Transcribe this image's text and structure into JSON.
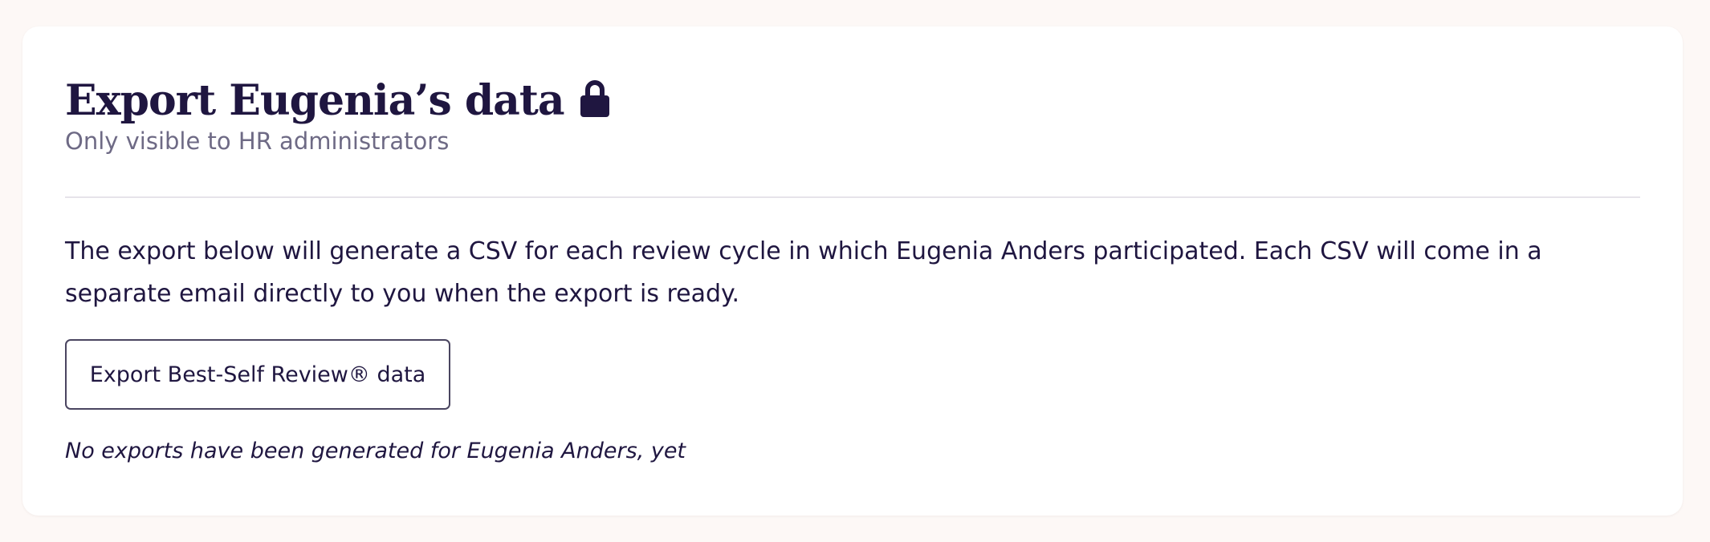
{
  "header": {
    "title": "Export Eugenia’s data",
    "title_icon": "lock-icon",
    "subtitle": "Only visible to HR administrators"
  },
  "body": {
    "description": "The export below will generate a CSV for each review cycle in which Eugenia Anders participated. Each CSV will come in a separate email directly to you when the export is ready.",
    "export_button_label": "Export Best-Self Review® data",
    "empty_state": "No exports have been generated for Eugenia Anders, yet"
  },
  "colors": {
    "page_background": "#fdf8f6",
    "card_background": "#ffffff",
    "text_primary": "#1f1640",
    "text_secondary": "#6e6a85",
    "divider": "#e6e3ea",
    "button_border": "#4a4560"
  }
}
